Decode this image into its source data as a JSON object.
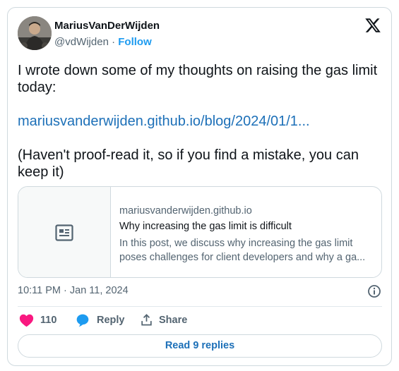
{
  "author": {
    "name": "MariusVanDerWijden",
    "handle": "@vdWijden",
    "separator": "·",
    "follow_label": "Follow"
  },
  "tweet": {
    "line1": "I wrote down some of my thoughts on raising the gas limit today:",
    "link": "mariusvanderwijden.github.io/blog/2024/01/1...",
    "line2": "(Haven't proof-read it, so if you find a mistake, you can keep it)"
  },
  "link_card": {
    "domain": "mariusvanderwijden.github.io",
    "title": "Why increasing the gas limit is difficult",
    "desc_line1": "In this post, we discuss why increasing the gas limit",
    "desc_line2": "poses challenges for client developers and why a ga..."
  },
  "timestamp": "10:11 PM · Jan 11, 2024",
  "actions": {
    "likes": "110",
    "reply_label": "Reply",
    "share_label": "Share"
  },
  "read_replies_label": "Read 9 replies",
  "colors": {
    "like": "#f91880",
    "reply": "#1d9bf0",
    "link": "#1d70b8",
    "muted": "#536471"
  }
}
